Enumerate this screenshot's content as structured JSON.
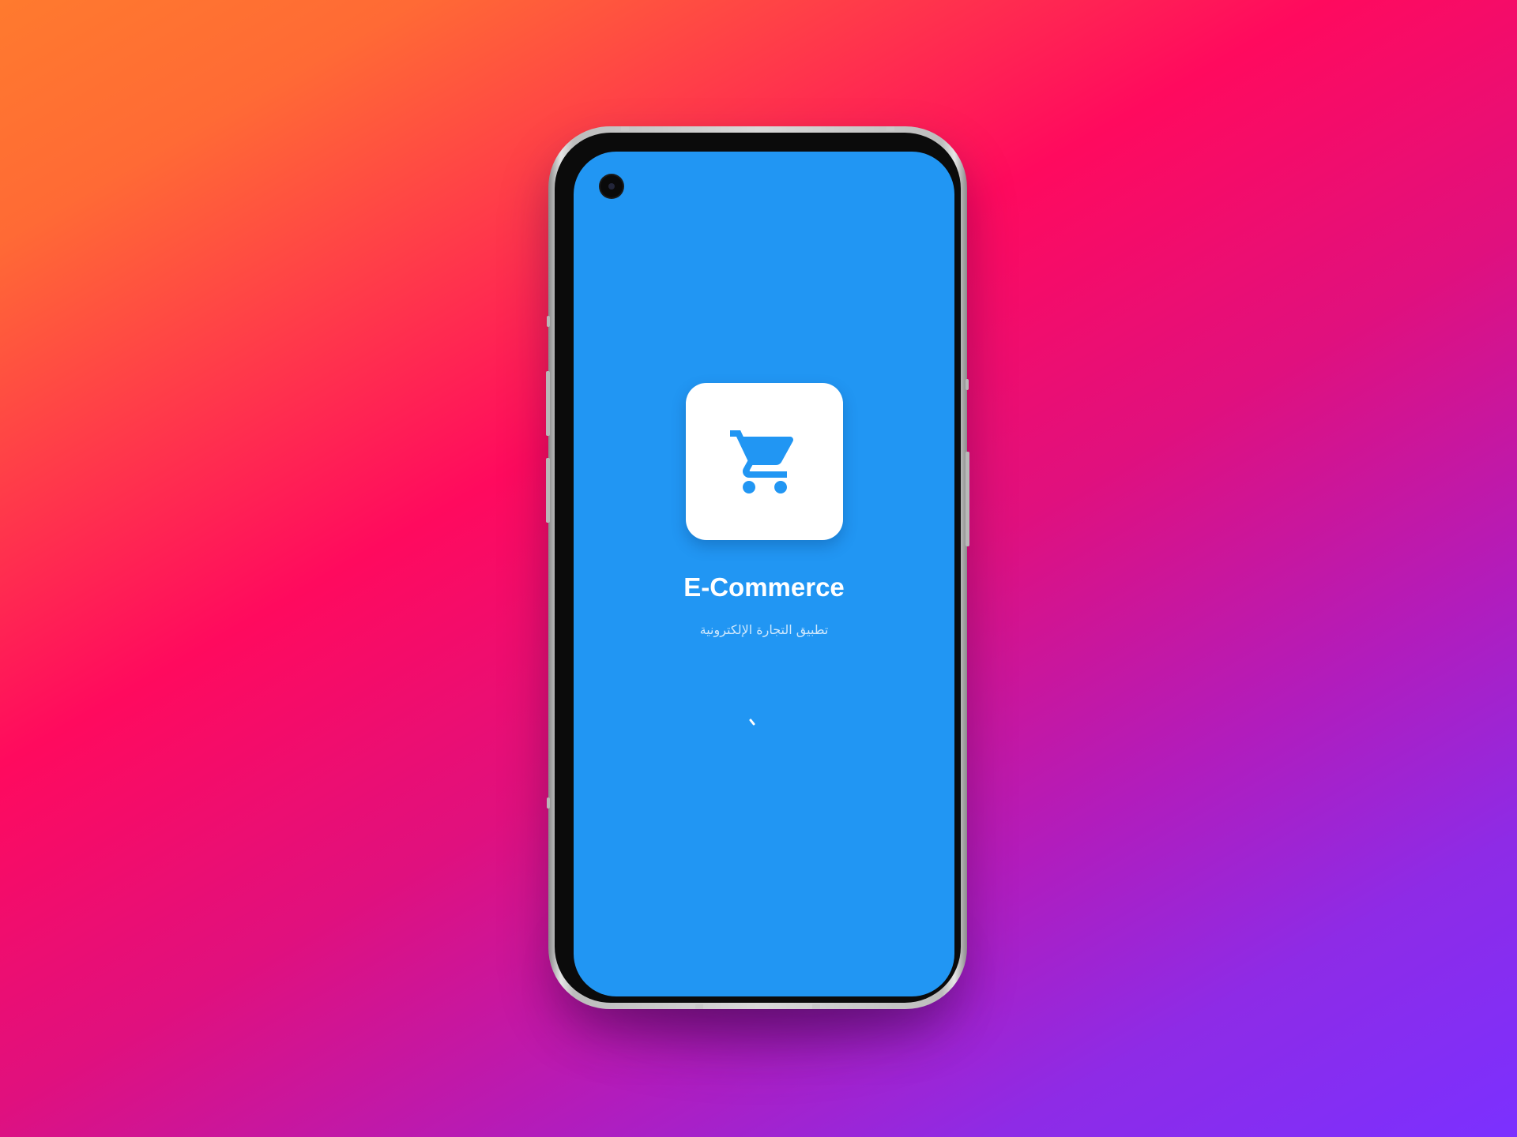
{
  "app": {
    "title": "E-Commerce",
    "subtitle": "تطبيق التجارة الإلكترونية"
  },
  "icons": {
    "app_icon": "shopping-cart-icon",
    "loader": "loading-spinner-icon"
  },
  "colors": {
    "screen_background": "#2196f3",
    "icon_tile": "#ffffff",
    "cart_icon": "#2196f3"
  }
}
